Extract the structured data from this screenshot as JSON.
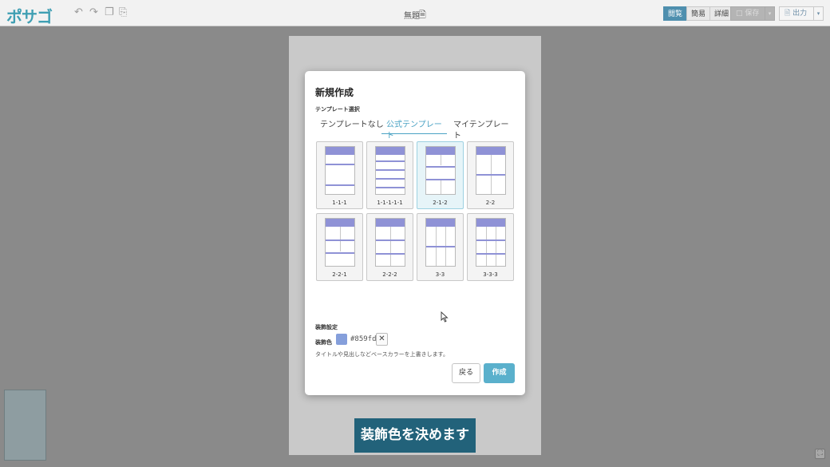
{
  "topbar": {
    "logo": "ポサゴ",
    "doc_title": "無題",
    "doc_icon": "document-icon",
    "modes": [
      "閲覧",
      "簡易",
      "詳細"
    ],
    "active_mode": "閲覧",
    "save_label": "保存",
    "export_label": "出力"
  },
  "modal": {
    "title": "新規作成",
    "template_section_label": "テンプレート選択",
    "tabs": [
      "テンプレートなし",
      "公式テンプレート",
      "マイテンプレート"
    ],
    "active_tab": "公式テンプレート",
    "templates": [
      {
        "label": "1-1-1",
        "selected": false
      },
      {
        "label": "1-1-1-1-1",
        "selected": false
      },
      {
        "label": "2-1-2",
        "selected": true
      },
      {
        "label": "2-2",
        "selected": false
      },
      {
        "label": "2-2-1",
        "selected": false
      },
      {
        "label": "2-2-2",
        "selected": false
      },
      {
        "label": "3-3",
        "selected": false
      },
      {
        "label": "3-3-3",
        "selected": false
      }
    ],
    "decoration_section_label": "装飾設定",
    "decoration_color_label": "装飾色",
    "decoration_color_value": "#859fdb",
    "decoration_hint": "タイトルや見出しなどベースカラーを上書きします。",
    "back_label": "戻る",
    "create_label": "作成"
  },
  "caption": "装飾色を決めます",
  "colors": {
    "accent": "#4ba3c4",
    "decoration": "#859fdb",
    "caption_bg": "#22627a"
  }
}
